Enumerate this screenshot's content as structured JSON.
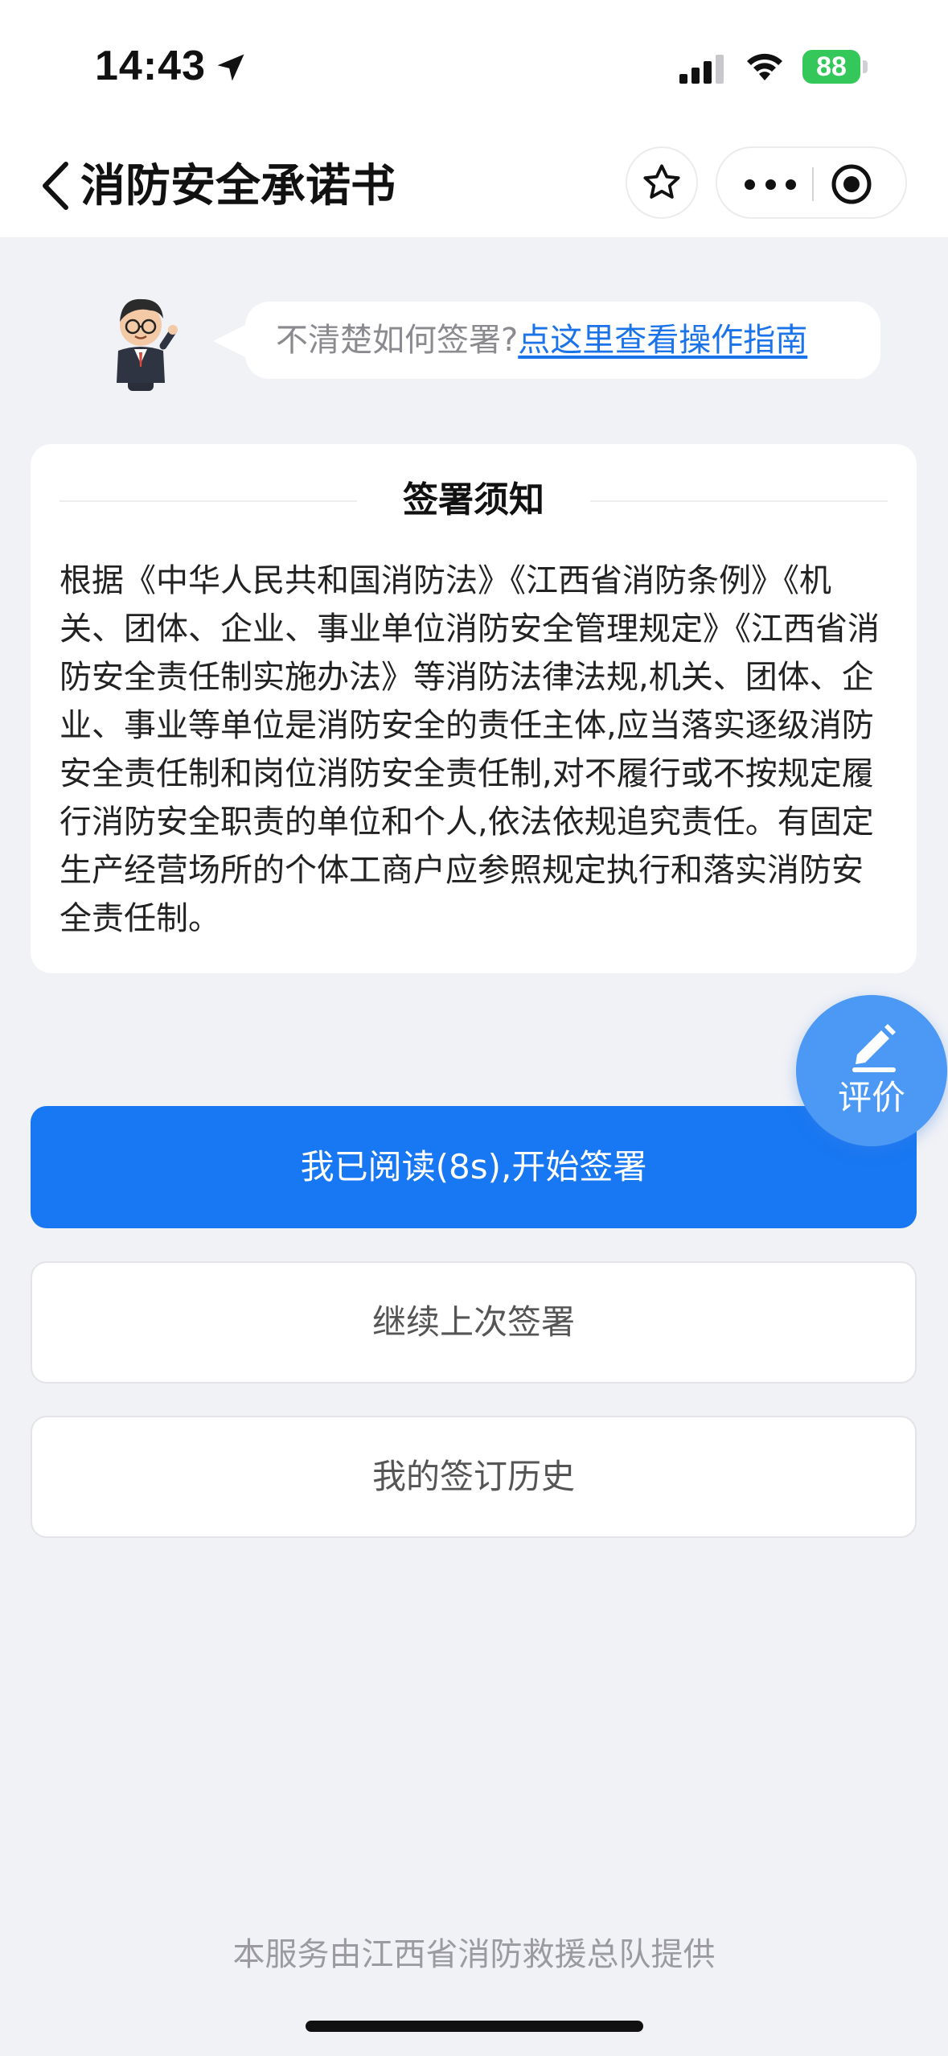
{
  "status_bar": {
    "time": "14:43",
    "battery": "88",
    "icons": [
      "location-arrow-icon",
      "cellular-signal-icon",
      "wifi-icon",
      "battery-charging-icon"
    ]
  },
  "nav": {
    "title": "消防安全承诺书",
    "icons": [
      "back-chevron-icon",
      "star-icon",
      "more-dots-icon",
      "target-icon"
    ]
  },
  "guide": {
    "question": "不清楚如何签署?",
    "link": "点这里查看操作指南"
  },
  "notice": {
    "title": "签署须知",
    "body": "根据《中华人民共和国消防法》《江西省消防条例》《机关、团体、企业、事业单位消防安全管理规定》《江西省消防安全责任制实施办法》等消防法律法规,机关、团体、企业、事业等单位是消防安全的责任主体,应当落实逐级消防安全责任制和岗位消防安全责任制,对不履行或不按规定履行消防安全职责的单位和个人,依法依规追究责任。有固定生产经营场所的个体工商户应参照规定执行和落实消防安全责任制。"
  },
  "fab": {
    "label": "评价",
    "icon": "pen-edit-icon"
  },
  "buttons": {
    "start": "我已阅读(8s),开始签署",
    "resume": "继续上次签署",
    "history": "我的签订历史"
  },
  "footer": "本服务由江西省消防救援总队提供",
  "colors": {
    "primary": "#1877f2",
    "link": "#1a73e8",
    "background": "#f1f2f6",
    "fab": "#4b98f5",
    "battery": "#34c759"
  }
}
